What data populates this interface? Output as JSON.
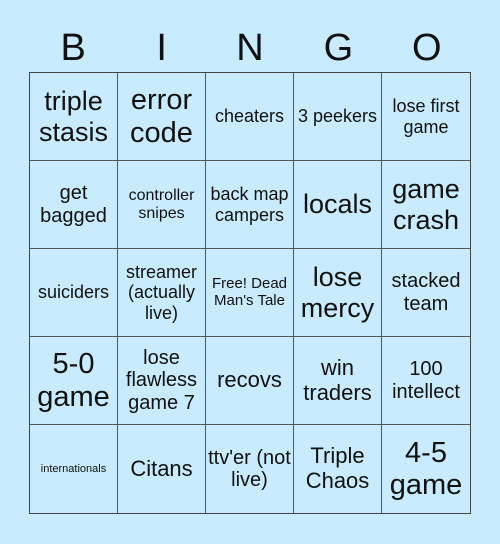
{
  "header": [
    "B",
    "I",
    "N",
    "G",
    "O"
  ],
  "cells": [
    [
      "triple stasis",
      "error code",
      "cheaters",
      "3 peekers",
      "lose first game"
    ],
    [
      "get bagged",
      "controller snipes",
      "back map campers",
      "locals",
      "game crash"
    ],
    [
      "suiciders",
      "streamer (actually live)",
      "Free! Dead Man's Tale",
      "lose mercy",
      "stacked team"
    ],
    [
      "5-0 game",
      "lose flawless game 7",
      "recovs",
      "win traders",
      "100 intellect"
    ],
    [
      "internationals",
      "Citans",
      "ttv'er (not live)",
      "Triple Chaos",
      "4-5 game"
    ]
  ],
  "colors": {
    "background": "#C8ECFD",
    "border": "#555555",
    "text": "#111111"
  }
}
